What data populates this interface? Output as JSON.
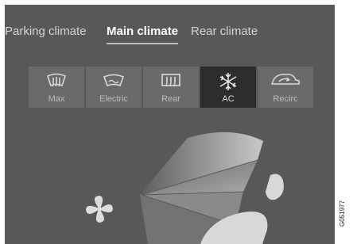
{
  "tabs": [
    {
      "label": "Parking climate",
      "active": false
    },
    {
      "label": "Main climate",
      "active": true
    },
    {
      "label": "Rear climate",
      "active": false
    }
  ],
  "buttons": [
    {
      "label": "Max",
      "icon": "max-defrost-icon",
      "active": false
    },
    {
      "label": "Electric",
      "icon": "electric-windscreen-icon",
      "active": false
    },
    {
      "label": "Rear",
      "icon": "rear-defrost-icon",
      "active": false
    },
    {
      "label": "AC",
      "icon": "ac-snowflake-icon",
      "active": true
    },
    {
      "label": "Recirc",
      "icon": "recirculation-icon",
      "active": false
    }
  ],
  "figure_id": "G051977",
  "colors": {
    "screen_bg": "#585858",
    "button_bg": "#6a6a6a",
    "button_active_bg": "#2c2c2c",
    "text": "#d4d4d4",
    "text_active": "#ffffff"
  }
}
